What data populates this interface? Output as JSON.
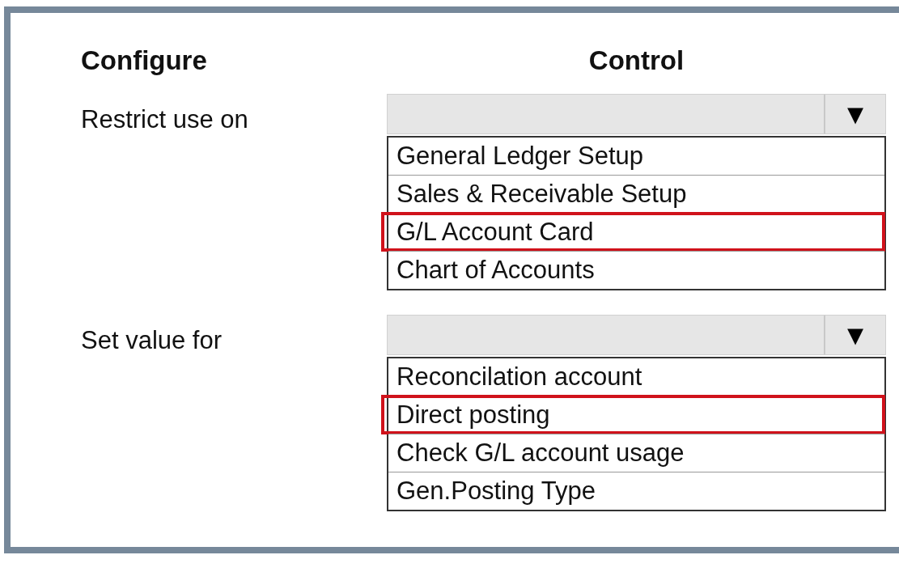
{
  "headers": {
    "configure": "Configure",
    "control": "Control"
  },
  "rows": [
    {
      "label": "Restrict use on",
      "dropdown_arrow": "▼",
      "options": [
        {
          "label": "General Ledger Setup",
          "selected": false
        },
        {
          "label": "Sales & Receivable Setup",
          "selected": false
        },
        {
          "label": "G/L Account Card",
          "selected": true
        },
        {
          "label": "Chart of Accounts",
          "selected": false
        }
      ]
    },
    {
      "label": "Set value for",
      "dropdown_arrow": "▼",
      "options": [
        {
          "label": "Reconcilation account",
          "selected": false
        },
        {
          "label": "Direct posting",
          "selected": true
        },
        {
          "label": "Check G/L account usage",
          "selected": false
        },
        {
          "label": "Gen.Posting Type",
          "selected": false
        }
      ]
    }
  ]
}
